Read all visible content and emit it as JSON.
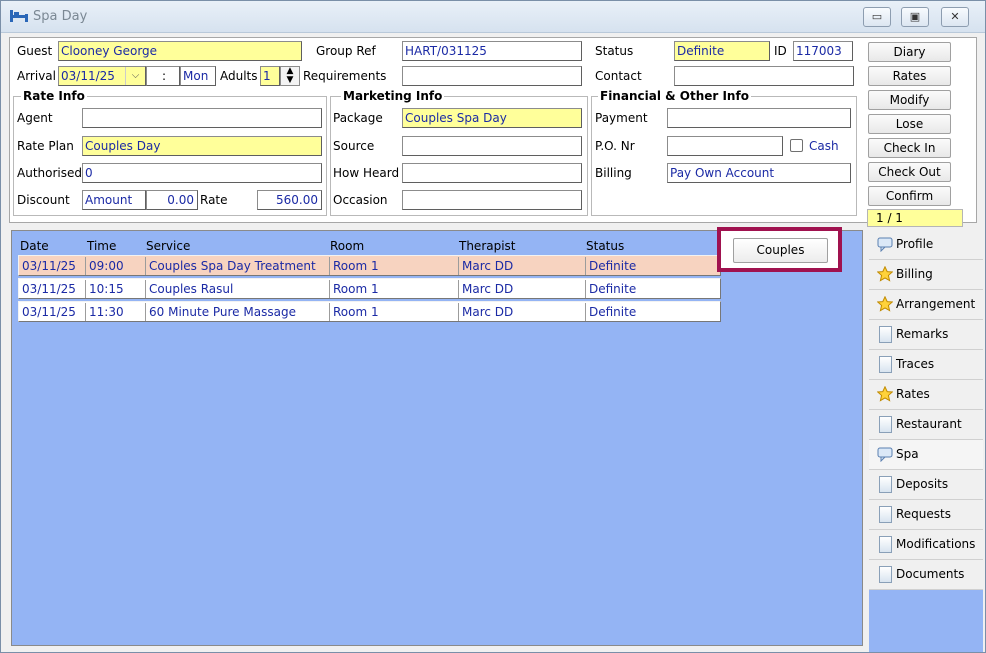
{
  "window": {
    "title": "Spa Day",
    "buttons": {
      "minimize": "▭",
      "maximize": "▣",
      "close": "✕"
    }
  },
  "header": {
    "guest": {
      "label": "Guest",
      "value": "Clooney George"
    },
    "group_ref": {
      "label": "Group Ref",
      "value": "HART/031125"
    },
    "status": {
      "label": "Status",
      "value": "Definite"
    },
    "id": {
      "label": "ID",
      "value": "117003"
    },
    "arrival": {
      "label": "Arrival",
      "value": "03/11/25",
      "time": ":",
      "day": "Mon"
    },
    "adults": {
      "label": "Adults",
      "value": "1"
    },
    "requirements": {
      "label": "Requirements",
      "value": ""
    },
    "contact": {
      "label": "Contact",
      "value": ""
    }
  },
  "rate_info": {
    "title": "Rate Info",
    "agent": {
      "label": "Agent",
      "value": ""
    },
    "rate_plan": {
      "label": "Rate Plan",
      "value": "Couples Day"
    },
    "authorised": {
      "label": "Authorised",
      "value": "0"
    },
    "discount": {
      "label": "Discount",
      "type": "Amount",
      "value": "0.00"
    },
    "rate": {
      "label": "Rate",
      "value": "560.00"
    }
  },
  "marketing_info": {
    "title": "Marketing Info",
    "package": {
      "label": "Package",
      "value": "Couples Spa Day"
    },
    "source": {
      "label": "Source",
      "value": ""
    },
    "how_heard": {
      "label": "How Heard",
      "value": ""
    },
    "occasion": {
      "label": "Occasion",
      "value": ""
    }
  },
  "financial_info": {
    "title": "Financial & Other Info",
    "payment": {
      "label": "Payment",
      "value": ""
    },
    "po_nr": {
      "label": "P.O. Nr",
      "value": ""
    },
    "cash_label": "Cash",
    "billing": {
      "label": "Billing",
      "value": "Pay Own Account"
    }
  },
  "side_buttons": [
    "Diary",
    "Rates",
    "Modify",
    "Lose",
    "Check In",
    "Check Out",
    "Confirm"
  ],
  "pager": "1 / 1",
  "table": {
    "columns": [
      "Date",
      "Time",
      "Service",
      "Room",
      "Therapist",
      "Status"
    ],
    "rows": [
      {
        "date": "03/11/25",
        "time": "09:00",
        "service": "Couples Spa Day Treatment",
        "room": "Room 1",
        "therapist": "Marc DD",
        "status": "Definite"
      },
      {
        "date": "03/11/25",
        "time": "10:15",
        "service": "Couples Rasul",
        "room": "Room 1",
        "therapist": "Marc DD",
        "status": "Definite"
      },
      {
        "date": "03/11/25",
        "time": "11:30",
        "service": "60 Minute Pure Massage",
        "room": "Room 1",
        "therapist": "Marc DD",
        "status": "Definite"
      }
    ]
  },
  "couples_button": "Couples",
  "tabs": [
    {
      "label": "Profile",
      "icon": "speech-bubble-icon"
    },
    {
      "label": "Billing",
      "icon": "star-icon"
    },
    {
      "label": "Arrangement",
      "icon": "star-icon"
    },
    {
      "label": "Remarks",
      "icon": "document-icon"
    },
    {
      "label": "Traces",
      "icon": "document-icon"
    },
    {
      "label": "Rates",
      "icon": "star-icon"
    },
    {
      "label": "Restaurant",
      "icon": "document-icon"
    },
    {
      "label": "Spa",
      "icon": "speech-bubble-icon"
    },
    {
      "label": "Deposits",
      "icon": "document-icon"
    },
    {
      "label": "Requests",
      "icon": "document-icon"
    },
    {
      "label": "Modifications",
      "icon": "document-icon"
    },
    {
      "label": "Documents",
      "icon": "document-icon"
    }
  ],
  "colors": {
    "highlight_field": "#ffff9a",
    "value_text": "#1b2aa5",
    "grid_background": "#94b4f4",
    "selected_row": "#f7d3c0",
    "callout_border": "#a0124f"
  }
}
